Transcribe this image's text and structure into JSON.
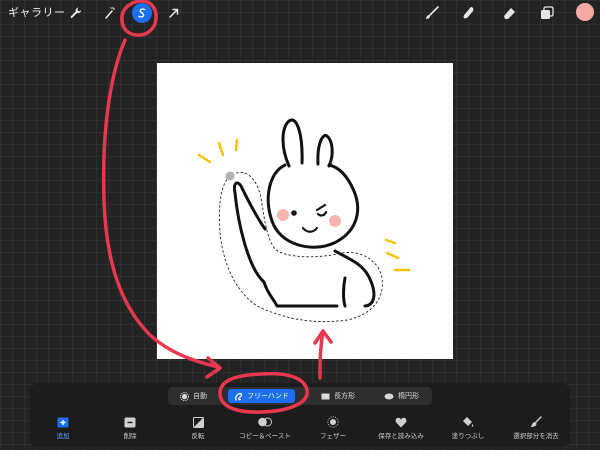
{
  "topbar": {
    "gallery_label": "ギャラリー",
    "left_icons": [
      "wrench-icon",
      "magic-wand-icon",
      "selection-s-icon",
      "arrow-cursor-icon"
    ],
    "right_icons": [
      "brush-icon",
      "smudge-icon",
      "eraser-icon",
      "layers-icon",
      "color-swatch-icon"
    ],
    "color_swatch": "#f4a9a5",
    "accent": "#1d6ff2"
  },
  "selection_modes": [
    {
      "label": "自動",
      "icon": "gear-icon",
      "active": false
    },
    {
      "label": "フリーハンド",
      "icon": "freehand-icon",
      "active": true
    },
    {
      "label": "長方形",
      "icon": "rectangle-icon",
      "active": false
    },
    {
      "label": "楕円形",
      "icon": "ellipse-icon",
      "active": false
    }
  ],
  "tools": [
    {
      "label": "追加",
      "icon": "plus-square-icon"
    },
    {
      "label": "削除",
      "icon": "minus-square-icon"
    },
    {
      "label": "反転",
      "icon": "invert-icon"
    },
    {
      "label": "コピー＆ペースト",
      "icon": "copy-paste-icon"
    },
    {
      "label": "フェザー",
      "icon": "feather-icon"
    },
    {
      "label": "保存と読み込み",
      "icon": "heart-icon"
    },
    {
      "label": "塗りつぶし",
      "icon": "fill-icon"
    },
    {
      "label": "選択部分を消去",
      "icon": "clear-icon"
    }
  ],
  "annotation_color": "#e8384f"
}
